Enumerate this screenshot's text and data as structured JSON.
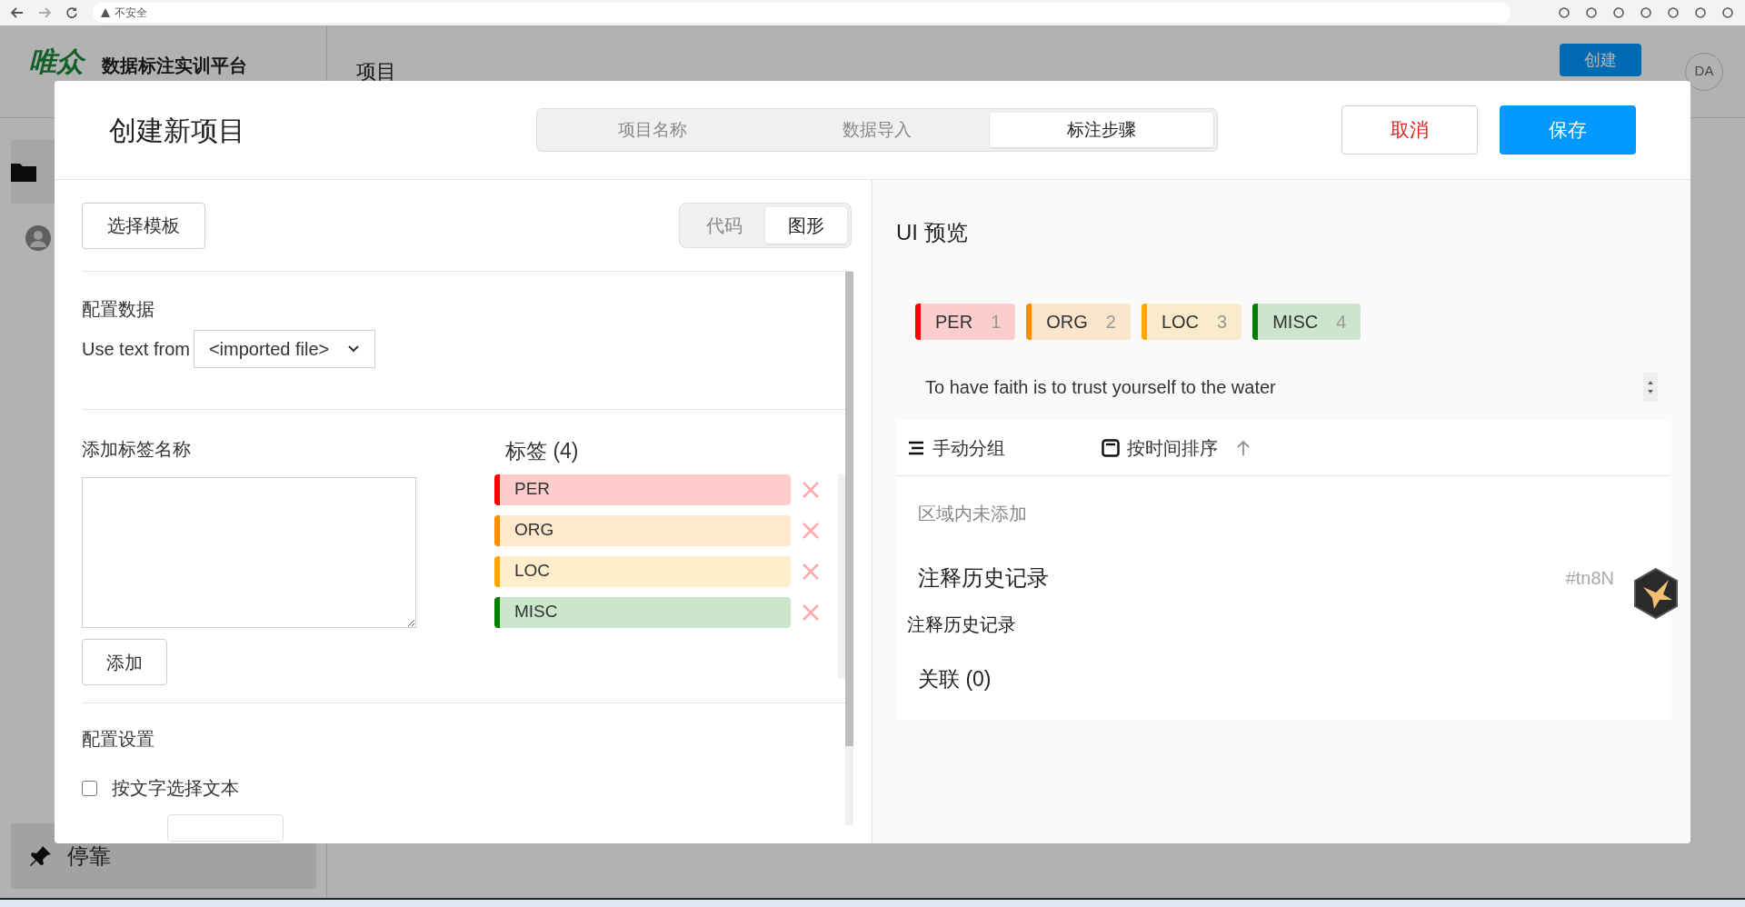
{
  "browser": {
    "security": "不安全"
  },
  "app": {
    "logo": "唯众",
    "title": "数据标注实训平台",
    "nav": "项目",
    "create_button": "创建",
    "avatar": "DA",
    "dock": "停靠"
  },
  "modal": {
    "title": "创建新项目",
    "steps": [
      {
        "label": "项目名称",
        "selected": false
      },
      {
        "label": "数据导入",
        "selected": false
      },
      {
        "label": "标注步骤",
        "selected": true
      }
    ],
    "cancel": "取消",
    "save": "保存",
    "template_button": "选择模板",
    "modes": [
      {
        "label": "代码",
        "selected": false
      },
      {
        "label": "图形",
        "selected": true
      }
    ],
    "config_data": {
      "heading": "配置数据",
      "label": "Use text from",
      "value": "<imported file>"
    },
    "add_label": {
      "heading": "添加标签名称",
      "button": "添加"
    },
    "labels": {
      "heading": "标签 (4)",
      "items": [
        {
          "name": "PER",
          "color": "#ff0000"
        },
        {
          "name": "ORG",
          "color": "#ff8c00"
        },
        {
          "name": "LOC",
          "color": "#ffa500"
        },
        {
          "name": "MISC",
          "color": "#008000"
        }
      ]
    },
    "settings": {
      "heading": "配置设置",
      "options": [
        {
          "label": "按文字选择文本",
          "checked": false
        }
      ]
    },
    "preview": {
      "heading": "UI 预览",
      "chips": [
        {
          "name": "PER",
          "hotkey": "1",
          "color": "#ff0000"
        },
        {
          "name": "ORG",
          "hotkey": "2",
          "color": "#ff8c00"
        },
        {
          "name": "LOC",
          "hotkey": "3",
          "color": "#ffa500"
        },
        {
          "name": "MISC",
          "hotkey": "4",
          "color": "#008000"
        }
      ],
      "text": "To have faith is to trust yourself to the water",
      "group_button": "手动分组",
      "sort_button": "按时间排序",
      "empty": "区域内未添加",
      "history_heading": "注释历史记录",
      "history_id": "#tn8N",
      "history_text": "注释历史记录",
      "relations": "关联 (0)"
    }
  }
}
